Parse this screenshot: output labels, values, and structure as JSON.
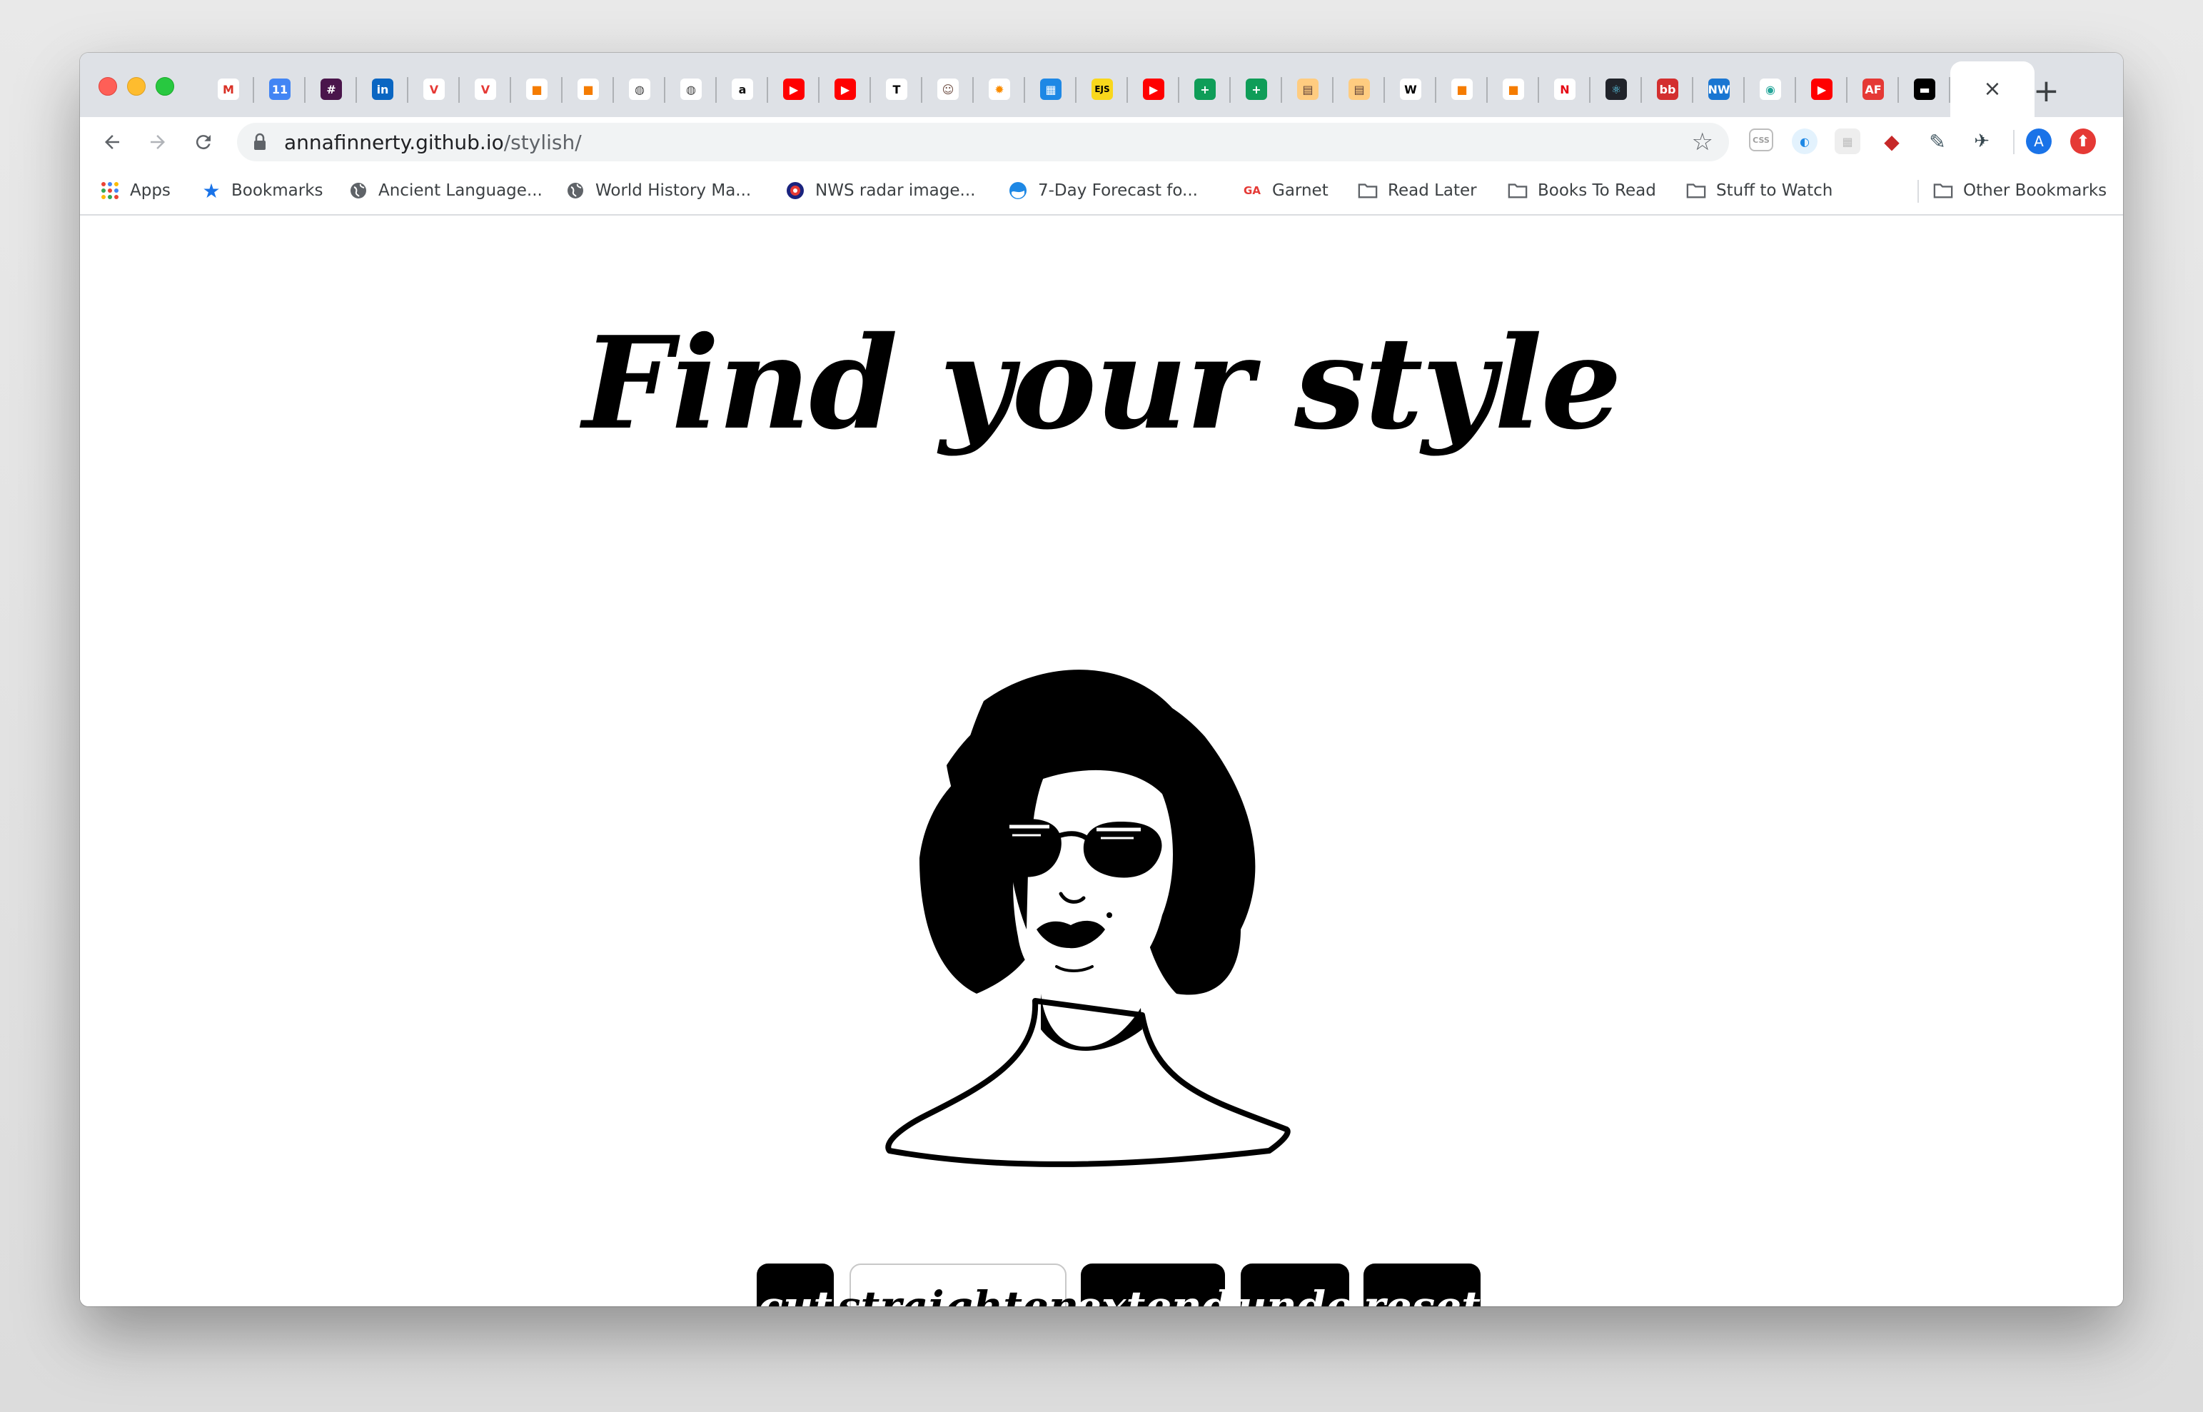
{
  "browser": {
    "tab_favicons": [
      {
        "icon": "gmail-icon",
        "glyph": "M",
        "bg": "#ffffff",
        "fg": "#d93025"
      },
      {
        "icon": "calendar-icon",
        "glyph": "11",
        "bg": "#4285f4",
        "fg": "#ffffff"
      },
      {
        "icon": "slack-icon",
        "glyph": "#",
        "bg": "#4a154b",
        "fg": "#ffffff"
      },
      {
        "icon": "linkedin-icon",
        "glyph": "in",
        "bg": "#0a66c2",
        "fg": "#ffffff"
      },
      {
        "icon": "v-red-icon",
        "glyph": "V",
        "bg": "#ffffff",
        "fg": "#e53935"
      },
      {
        "icon": "v-red-icon",
        "glyph": "V",
        "bg": "#ffffff",
        "fg": "#e53935"
      },
      {
        "icon": "orange-box-icon",
        "glyph": "■",
        "bg": "#ffffff",
        "fg": "#f57c00"
      },
      {
        "icon": "orange-box-icon",
        "glyph": "■",
        "bg": "#ffffff",
        "fg": "#f57c00"
      },
      {
        "icon": "globe-icon",
        "glyph": "◍",
        "bg": "#ffffff",
        "fg": "#444444"
      },
      {
        "icon": "globe-icon",
        "glyph": "◍",
        "bg": "#ffffff",
        "fg": "#444444"
      },
      {
        "icon": "amazon-icon",
        "glyph": "a",
        "bg": "#ffffff",
        "fg": "#111111"
      },
      {
        "icon": "youtube-icon",
        "glyph": "▶",
        "bg": "#ff0000",
        "fg": "#ffffff"
      },
      {
        "icon": "youtube-icon",
        "glyph": "▶",
        "bg": "#ff0000",
        "fg": "#ffffff"
      },
      {
        "icon": "nytimes-icon",
        "glyph": "T",
        "bg": "#ffffff",
        "fg": "#000000"
      },
      {
        "icon": "monkey-icon",
        "glyph": "☺",
        "bg": "#ffffff",
        "fg": "#6d4c41"
      },
      {
        "icon": "sun-icon",
        "glyph": "✹",
        "bg": "#ffffff",
        "fg": "#fb8c00"
      },
      {
        "icon": "grid-icon",
        "glyph": "▦",
        "bg": "#1e88e5",
        "fg": "#ffffff"
      },
      {
        "icon": "ejs-icon",
        "glyph": "EJS",
        "bg": "#f9d71c",
        "fg": "#000000"
      },
      {
        "icon": "youtube-icon",
        "glyph": "▶",
        "bg": "#ff0000",
        "fg": "#ffffff"
      },
      {
        "icon": "sheets-icon",
        "glyph": "+",
        "bg": "#0f9d58",
        "fg": "#ffffff"
      },
      {
        "icon": "sheets-icon",
        "glyph": "+",
        "bg": "#0f9d58",
        "fg": "#ffffff"
      },
      {
        "icon": "book-icon",
        "glyph": "▤",
        "bg": "#ffcc80",
        "fg": "#5d4037"
      },
      {
        "icon": "book-icon",
        "glyph": "▤",
        "bg": "#ffcc80",
        "fg": "#5d4037"
      },
      {
        "icon": "wikipedia-icon",
        "glyph": "W",
        "bg": "#ffffff",
        "fg": "#000000"
      },
      {
        "icon": "orange-box-icon",
        "glyph": "■",
        "bg": "#ffffff",
        "fg": "#f57c00"
      },
      {
        "icon": "orange-box-icon",
        "glyph": "■",
        "bg": "#ffffff",
        "fg": "#f57c00"
      },
      {
        "icon": "netflix-icon",
        "glyph": "N",
        "bg": "#ffffff",
        "fg": "#e50914"
      },
      {
        "icon": "react-icon",
        "glyph": "⚛",
        "bg": "#20232a",
        "fg": "#61dafb"
      },
      {
        "icon": "bb-icon",
        "glyph": "bb",
        "bg": "#d32f2f",
        "fg": "#ffffff"
      },
      {
        "icon": "nw-icon",
        "glyph": "NW",
        "bg": "#1976d2",
        "fg": "#ffffff"
      },
      {
        "icon": "eye-icon",
        "glyph": "◉",
        "bg": "#ffffff",
        "fg": "#26a69a"
      },
      {
        "icon": "youtube-icon",
        "glyph": "▶",
        "bg": "#ff0000",
        "fg": "#ffffff"
      },
      {
        "icon": "af-icon",
        "glyph": "AF",
        "bg": "#e53935",
        "fg": "#ffffff"
      },
      {
        "icon": "dark-tab-icon",
        "glyph": "▬",
        "bg": "#000000",
        "fg": "#ffffff"
      }
    ],
    "active_tab_close": "×",
    "new_tab": "+",
    "url_host": "annafinnerty.github.io",
    "url_path": "/stylish/",
    "bookmarks": [
      {
        "label": "Apps",
        "icon": "apps-grid-icon"
      },
      {
        "label": "Bookmarks",
        "icon": "star-icon"
      },
      {
        "label": "Ancient Language...",
        "icon": "globe-icon"
      },
      {
        "label": "World History Ma...",
        "icon": "globe-icon"
      },
      {
        "label": "NWS radar image...",
        "icon": "nws-icon"
      },
      {
        "label": "7-Day Forecast fo...",
        "icon": "noaa-icon"
      },
      {
        "label": "Garnet",
        "icon": "ga-icon"
      },
      {
        "label": "Read Later",
        "icon": "folder-icon"
      },
      {
        "label": "Books To Read",
        "icon": "folder-icon"
      },
      {
        "label": "Stuff to Watch",
        "icon": "folder-icon"
      }
    ],
    "other_bookmarks": "Other Bookmarks",
    "ga_glyph": "GA",
    "profile_initial": "A"
  },
  "page": {
    "title": "Find your style",
    "buttons": [
      {
        "label": "cut",
        "style": "dark"
      },
      {
        "label": "straighten",
        "style": "light"
      },
      {
        "label": "extend",
        "style": "dark"
      },
      {
        "label": "undo",
        "style": "dark"
      },
      {
        "label": "reset",
        "style": "dark"
      }
    ]
  }
}
